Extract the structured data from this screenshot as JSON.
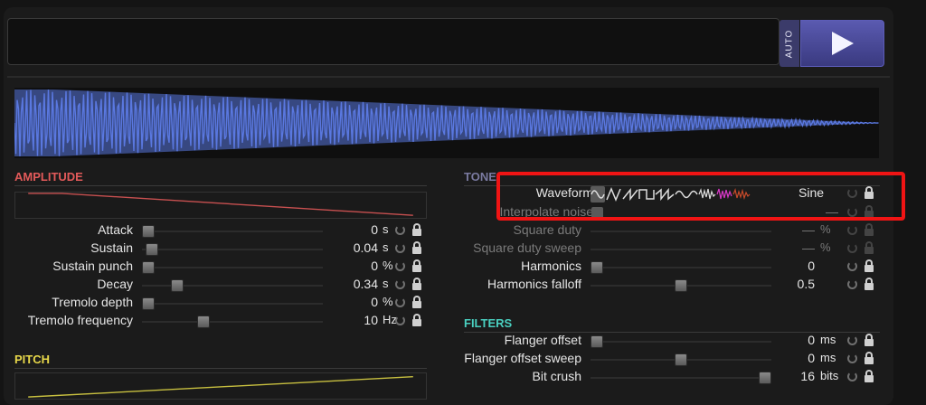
{
  "header": {
    "auto_label": "AUTO",
    "play_label": "Play"
  },
  "sections": {
    "amplitude": "AMPLITUDE",
    "pitch": "PITCH",
    "tone": "TONE",
    "filters": "FILTERS"
  },
  "amplitude": [
    {
      "label": "Attack",
      "value": "0",
      "unit": "s",
      "pos": 0.0
    },
    {
      "label": "Sustain",
      "value": "0.04",
      "unit": "s",
      "pos": 0.02
    },
    {
      "label": "Sustain punch",
      "value": "0",
      "unit": "%",
      "pos": 0.0
    },
    {
      "label": "Decay",
      "value": "0.34",
      "unit": "s",
      "pos": 0.17
    },
    {
      "label": "Tremolo depth",
      "value": "0",
      "unit": "%",
      "pos": 0.0
    },
    {
      "label": "Tremolo frequency",
      "value": "10",
      "unit": "Hz",
      "pos": 0.33
    }
  ],
  "tone": {
    "waveform": {
      "label": "Waveform",
      "value": "Sine"
    },
    "interpolate_noise": {
      "label": "Interpolate noise",
      "value": "—"
    },
    "rows": [
      {
        "label": "Square duty",
        "value": "—",
        "unit": "%",
        "pos": null,
        "dim": true
      },
      {
        "label": "Square duty sweep",
        "value": "—",
        "unit": "%",
        "pos": null,
        "dim": true
      },
      {
        "label": "Harmonics",
        "value": "0",
        "unit": "",
        "pos": 0.0,
        "dim": false
      },
      {
        "label": "Harmonics falloff",
        "value": "0.5",
        "unit": "",
        "pos": 0.5,
        "dim": false
      }
    ]
  },
  "filters": [
    {
      "label": "Flanger offset",
      "value": "0",
      "unit": "ms",
      "pos": 0.0
    },
    {
      "label": "Flanger offset sweep",
      "value": "0",
      "unit": "ms",
      "pos": 0.5
    },
    {
      "label": "Bit crush",
      "value": "16",
      "unit": "bits",
      "pos": 1.0
    }
  ],
  "colors": {
    "wave": "#5a78e0",
    "amp_env": "#c85050",
    "pitch_env": "#c8c040",
    "accent": "#4a4a9a"
  }
}
